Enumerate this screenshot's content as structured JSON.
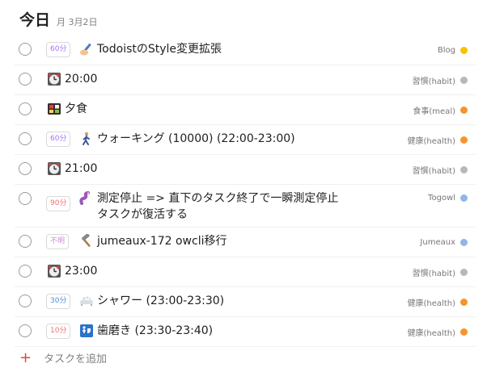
{
  "header": {
    "title": "今日",
    "date": "月 3月2日"
  },
  "tasks": [
    {
      "duration": "60分",
      "durationColor": "#a970ff",
      "icon": "writing-hand-icon",
      "title": "TodoistのStyle変更拡張",
      "label": "Blog",
      "dotColor": "#f5c400"
    },
    {
      "duration": "",
      "icon": "alarm-clock-icon",
      "title": "20:00",
      "label": "習慣(habit)",
      "dotColor": "#b8b8b8"
    },
    {
      "duration": "",
      "icon": "bento-box-icon",
      "title": "夕食",
      "label": "食事(meal)",
      "dotColor": "#f5942b"
    },
    {
      "duration": "60分",
      "durationColor": "#a970ff",
      "icon": "walking-person-icon",
      "title": "ウォーキング (10000) (22:00-23:00)",
      "label": "健康(health)",
      "dotColor": "#f5942b"
    },
    {
      "duration": "",
      "icon": "alarm-clock-icon",
      "title": "21:00",
      "label": "習慣(habit)",
      "dotColor": "#b8b8b8"
    },
    {
      "duration": "90分",
      "durationColor": "#f07171",
      "icon": "worm-icon",
      "title": "測定停止 => 直下のタスク終了で一瞬測定停止タスクが復活する",
      "label": "Togowl",
      "dotColor": "#8fb6e6"
    },
    {
      "duration": "不明",
      "durationColor": "#d08ad8",
      "icon": "hammer-icon",
      "title": "jumeaux-172 owcli移行",
      "label": "Jumeaux",
      "dotColor": "#8fb6e6"
    },
    {
      "duration": "",
      "icon": "alarm-clock-icon",
      "title": "23:00",
      "label": "習慣(habit)",
      "dotColor": "#b8b8b8"
    },
    {
      "duration": "30分",
      "durationColor": "#4a90e2",
      "icon": "bathtub-icon",
      "title": "シャワー (23:00-23:30)",
      "label": "健康(health)",
      "dotColor": "#f5942b"
    },
    {
      "duration": "10分",
      "durationColor": "#f07171",
      "icon": "bathroom-icon",
      "title": "歯磨き (23:30-23:40)",
      "label": "健康(health)",
      "dotColor": "#f5942b"
    }
  ],
  "addTask": {
    "label": "タスクを追加"
  }
}
